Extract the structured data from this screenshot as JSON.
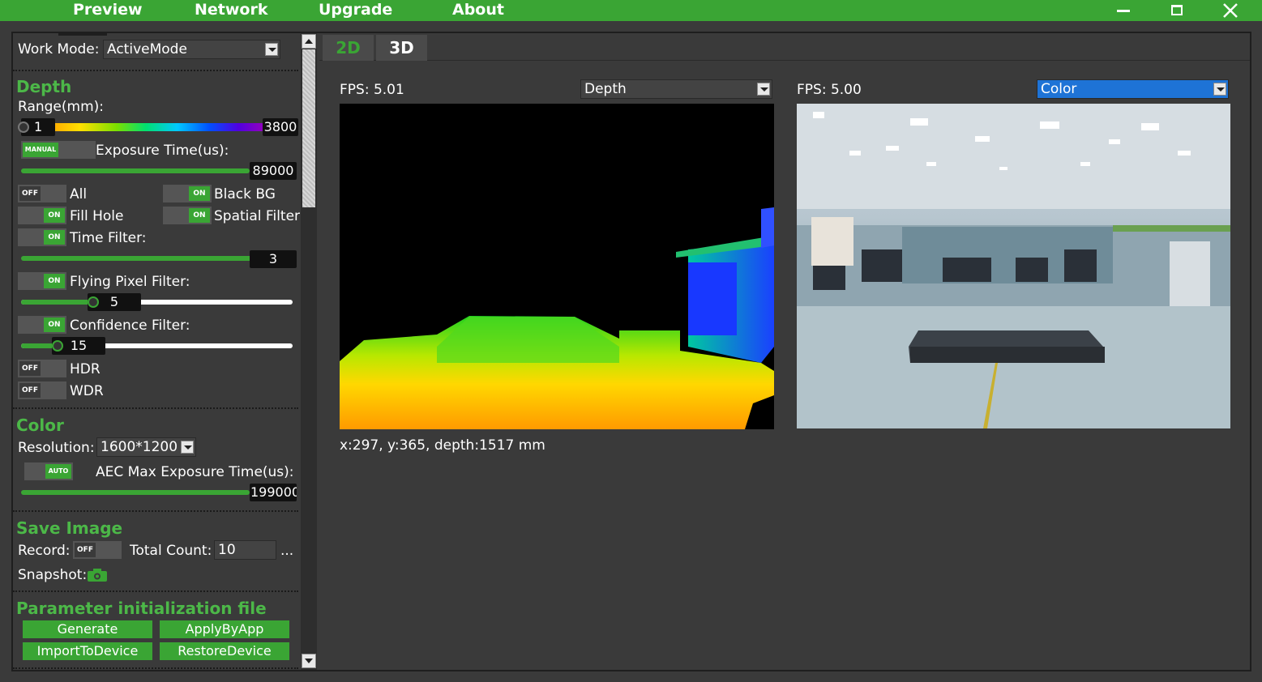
{
  "menu": {
    "preview": "Preview",
    "network": "Network",
    "upgrade": "Upgrade",
    "about": "About"
  },
  "left": {
    "work_mode_label": "Work Mode:",
    "work_mode_value": "ActiveMode",
    "depth": {
      "title": "Depth",
      "range_label": "Range(mm):",
      "range_min": "1",
      "range_max": "3800",
      "exposure_toggle": "MANUAL",
      "exposure_label": "Exposure Time(us):",
      "exposure_value": "89000",
      "all_toggle": "OFF",
      "all_label": "All",
      "blackbg_toggle": "ON",
      "blackbg_label": "Black BG",
      "fillhole_toggle": "ON",
      "fillhole_label": "Fill Hole",
      "spatial_toggle": "ON",
      "spatial_label": "Spatial Filter",
      "time_toggle": "ON",
      "time_label": "Time Filter:",
      "time_value": "3",
      "flying_toggle": "ON",
      "flying_label": "Flying Pixel Filter:",
      "flying_value": "5",
      "confidence_toggle": "ON",
      "confidence_label": "Confidence Filter:",
      "confidence_value": "15",
      "hdr_toggle": "OFF",
      "hdr_label": "HDR",
      "wdr_toggle": "OFF",
      "wdr_label": "WDR"
    },
    "color": {
      "title": "Color",
      "resolution_label": "Resolution:",
      "resolution_value": "1600*1200",
      "aec_toggle": "AUTO",
      "aec_label": "AEC Max Exposure Time(us):",
      "aec_value": "199000"
    },
    "save": {
      "title": "Save Image",
      "record_label": "Record:",
      "record_toggle": "OFF",
      "total_label": "Total Count:",
      "total_value": "10",
      "more": "...",
      "snapshot_label": "Snapshot:"
    },
    "param": {
      "title": "Parameter initialization file",
      "generate": "Generate",
      "apply": "ApplyByApp",
      "import": "ImportToDevice",
      "restore": "RestoreDevice"
    }
  },
  "tabs": {
    "t2d": "2D",
    "t3d": "3D"
  },
  "depth_view": {
    "fps": "FPS: 5.01",
    "stream": "Depth",
    "readout": "x:297, y:365, depth:1517 mm"
  },
  "color_view": {
    "fps": "FPS: 5.00",
    "stream": "Color"
  },
  "colors": {
    "accent": "#3aa534",
    "section_title": "#4cb848",
    "background": "#3a3a3a",
    "selected_combo": "#1e73d6"
  }
}
